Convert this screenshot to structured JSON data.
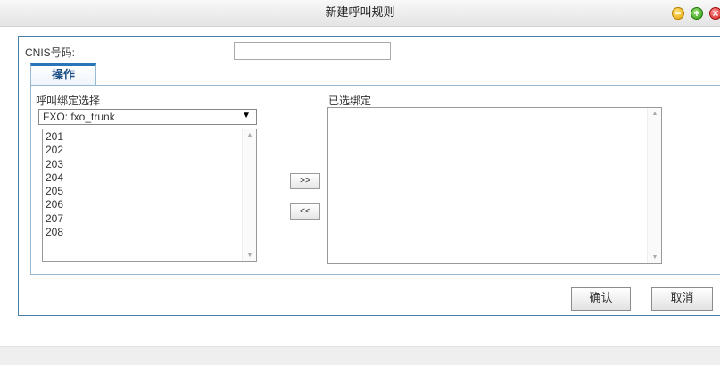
{
  "window": {
    "title": "新建呼叫规则",
    "minimize_icon": "−",
    "maximize_icon": "+",
    "close_icon": "×"
  },
  "form": {
    "cnis_label": "CNIS号码:",
    "cnis_value": ""
  },
  "tabs": [
    {
      "label": "操作",
      "active": true
    }
  ],
  "binding": {
    "source_label": "呼叫绑定选择",
    "source_select": {
      "selected": "FXO: fxo_trunk",
      "arrow": "▼"
    },
    "source_items": [
      "201",
      "202",
      "203",
      "204",
      "205",
      "206",
      "207",
      "208"
    ],
    "target_label": "已选绑定",
    "target_items": [],
    "move_right_label": ">>",
    "move_left_label": "<<"
  },
  "scrollbar": {
    "up_arrow": "▲",
    "down_arrow": "▼"
  },
  "actions": {
    "confirm_label": "确认",
    "cancel_label": "取消"
  },
  "colors": {
    "panel_border": "#4b7fa6",
    "tab_accent": "#2a74b8",
    "minimize": "#e7a400",
    "maximize": "#2e9b12",
    "close": "#d31b1b"
  }
}
